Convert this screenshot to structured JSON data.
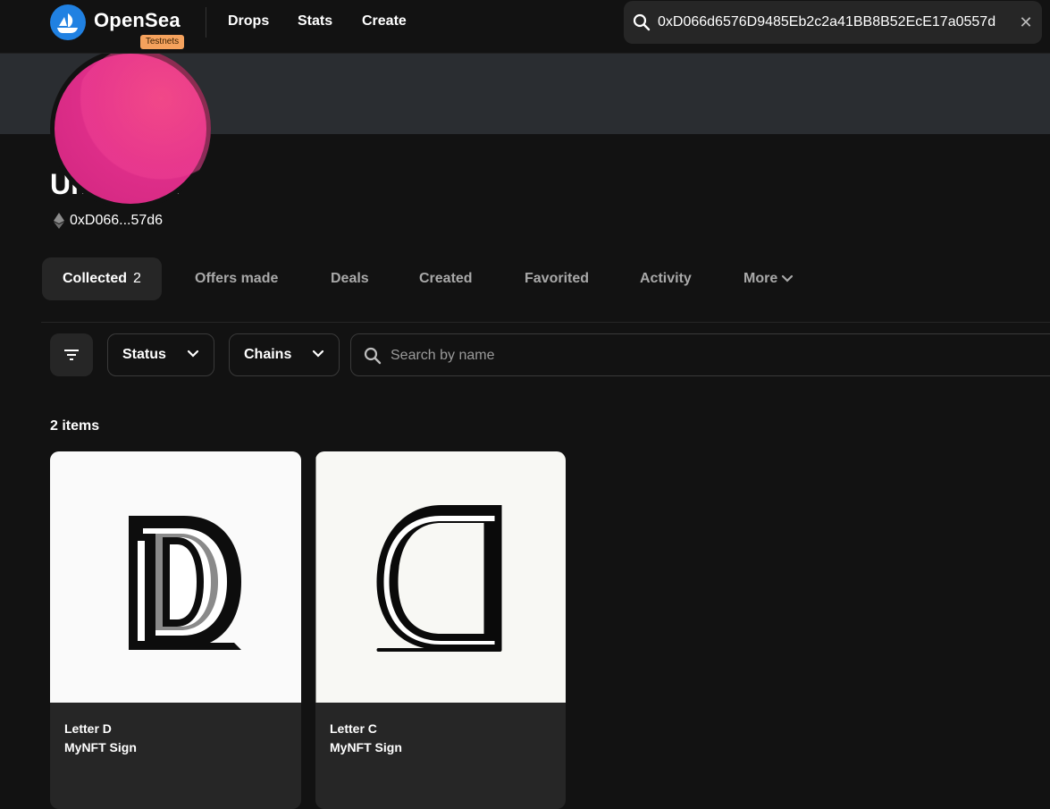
{
  "header": {
    "brand": "OpenSea",
    "badge": "Testnets",
    "nav": [
      "Drops",
      "Stats",
      "Create"
    ],
    "search_value": "0xD066d6576D9485Eb2c2a41BB8B52EcE17a0557d",
    "clear_glyph": "✕"
  },
  "profile": {
    "name": "Unnamed",
    "address_short": "0xD066...57d6",
    "avatar_color": "#e02f8a"
  },
  "tabs": [
    {
      "label": "Collected",
      "count": "2",
      "active": true
    },
    {
      "label": "Offers made"
    },
    {
      "label": "Deals"
    },
    {
      "label": "Created"
    },
    {
      "label": "Favorited"
    },
    {
      "label": "Activity"
    },
    {
      "label": "More"
    }
  ],
  "filters": {
    "status_label": "Status",
    "chains_label": "Chains",
    "search_placeholder": "Search by name"
  },
  "items_count": "2 items",
  "items": [
    {
      "title": "Letter D",
      "collection": "MyNFT Sign",
      "letter": "D"
    },
    {
      "title": "Letter C",
      "collection": "MyNFT Sign",
      "letter": "C"
    }
  ],
  "colors": {
    "background": "#121212",
    "surface": "#262626",
    "banner": "#2a2d31",
    "accent": "#2081e2",
    "testnet_badge": "#f5a25d"
  }
}
